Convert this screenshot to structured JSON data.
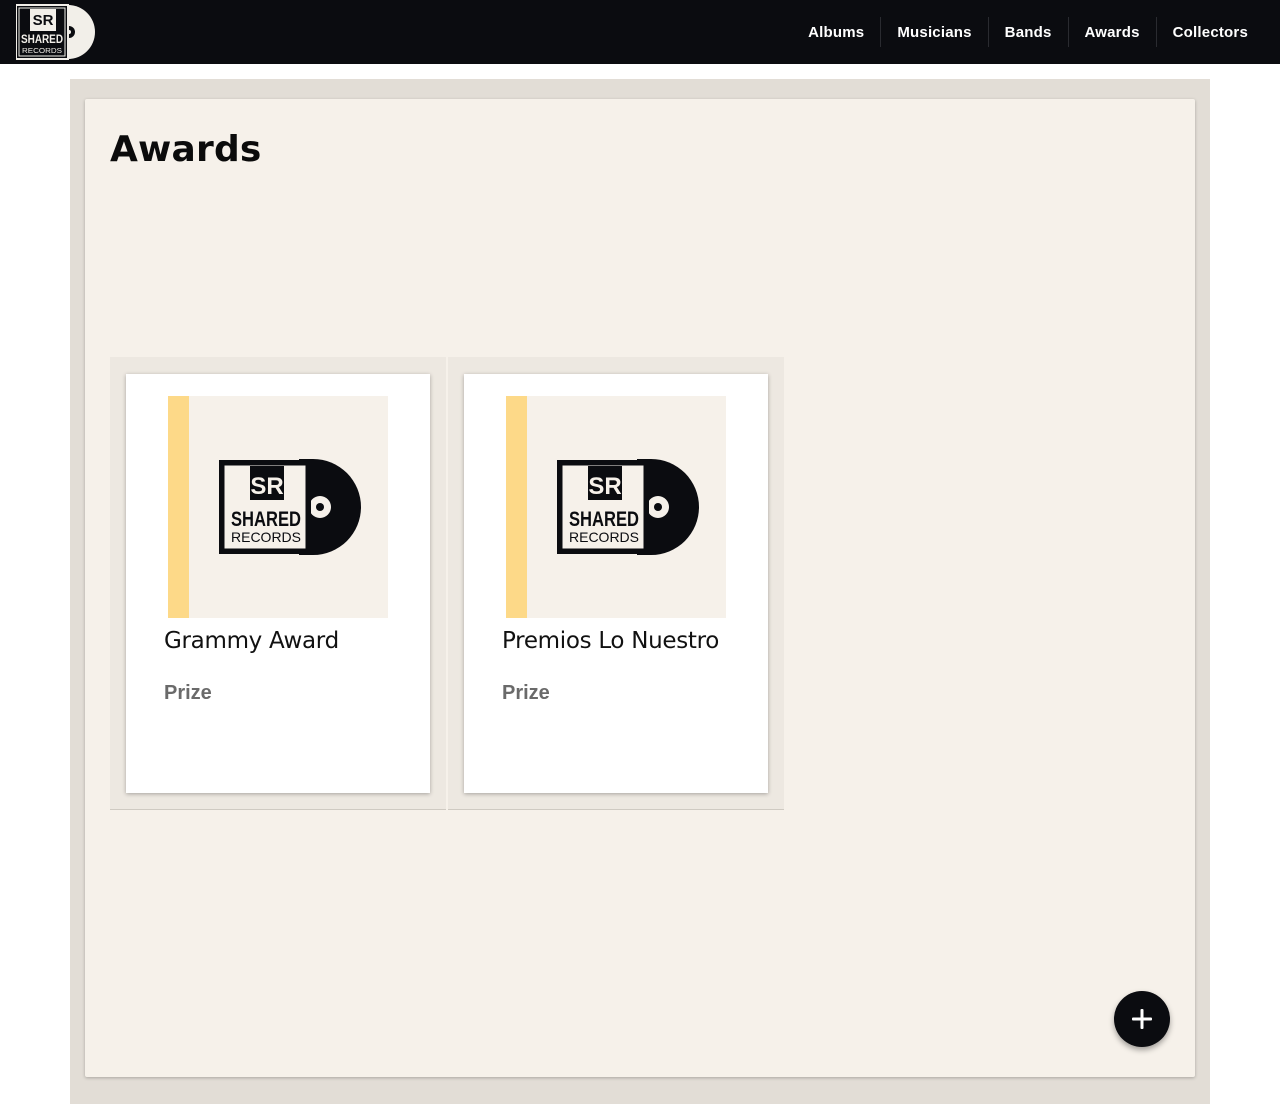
{
  "brand": {
    "logo_name": "shared-records-logo",
    "logo_text_top": "SR",
    "logo_text_mid": "SHARED",
    "logo_text_bottom": "RECORDS"
  },
  "nav": {
    "items": [
      {
        "label": "Albums"
      },
      {
        "label": "Musicians"
      },
      {
        "label": "Bands"
      },
      {
        "label": "Awards"
      },
      {
        "label": "Collectors"
      }
    ]
  },
  "page": {
    "title": "Awards"
  },
  "awards": [
    {
      "name": "Grammy Award",
      "type": "Prize"
    },
    {
      "name": "Premios Lo Nuestro",
      "type": "Prize"
    }
  ],
  "fab": {
    "icon": "plus-icon"
  },
  "colors": {
    "topbar": "#0b0c10",
    "frame": "#e2ddd6",
    "panel": "#f6f1ea",
    "accent_stripe": "#fdd988"
  }
}
